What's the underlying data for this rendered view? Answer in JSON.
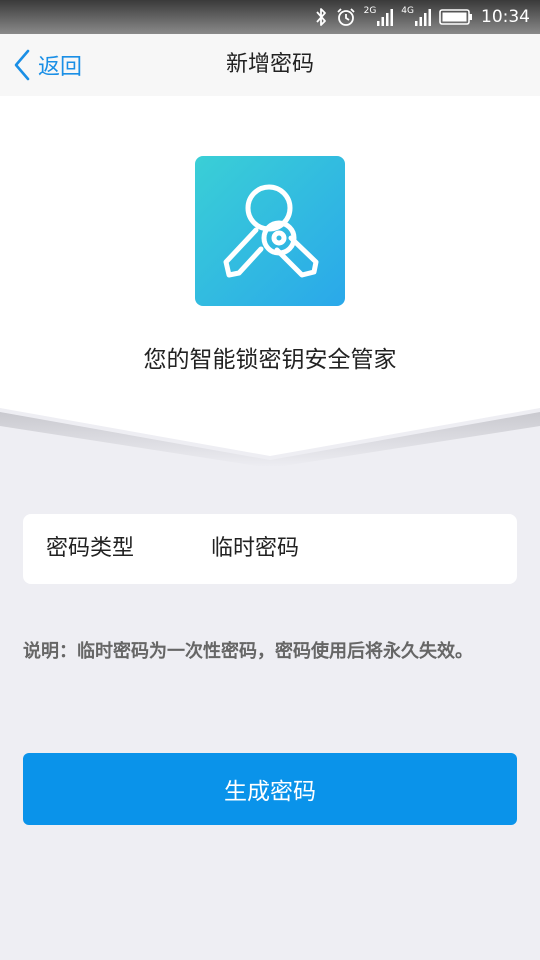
{
  "status_bar": {
    "network_2g": "2G",
    "network_4g": "4G",
    "time": "10:34"
  },
  "nav": {
    "back_label": "返回",
    "title": "新增密码"
  },
  "hero": {
    "icon": "keys-icon",
    "caption": "您的智能锁密钥安全管家"
  },
  "password_type": {
    "label": "密码类型",
    "value": "临时密码"
  },
  "note": "说明：临时密码为一次性密码，密码使用后将永久失效。",
  "generate_button": "生成密码",
  "colors": {
    "accent": "#0a93ea",
    "icon_gradient_start": "#3acfd6",
    "icon_gradient_end": "#2aa8ea",
    "page_background": "#eeeef3"
  }
}
